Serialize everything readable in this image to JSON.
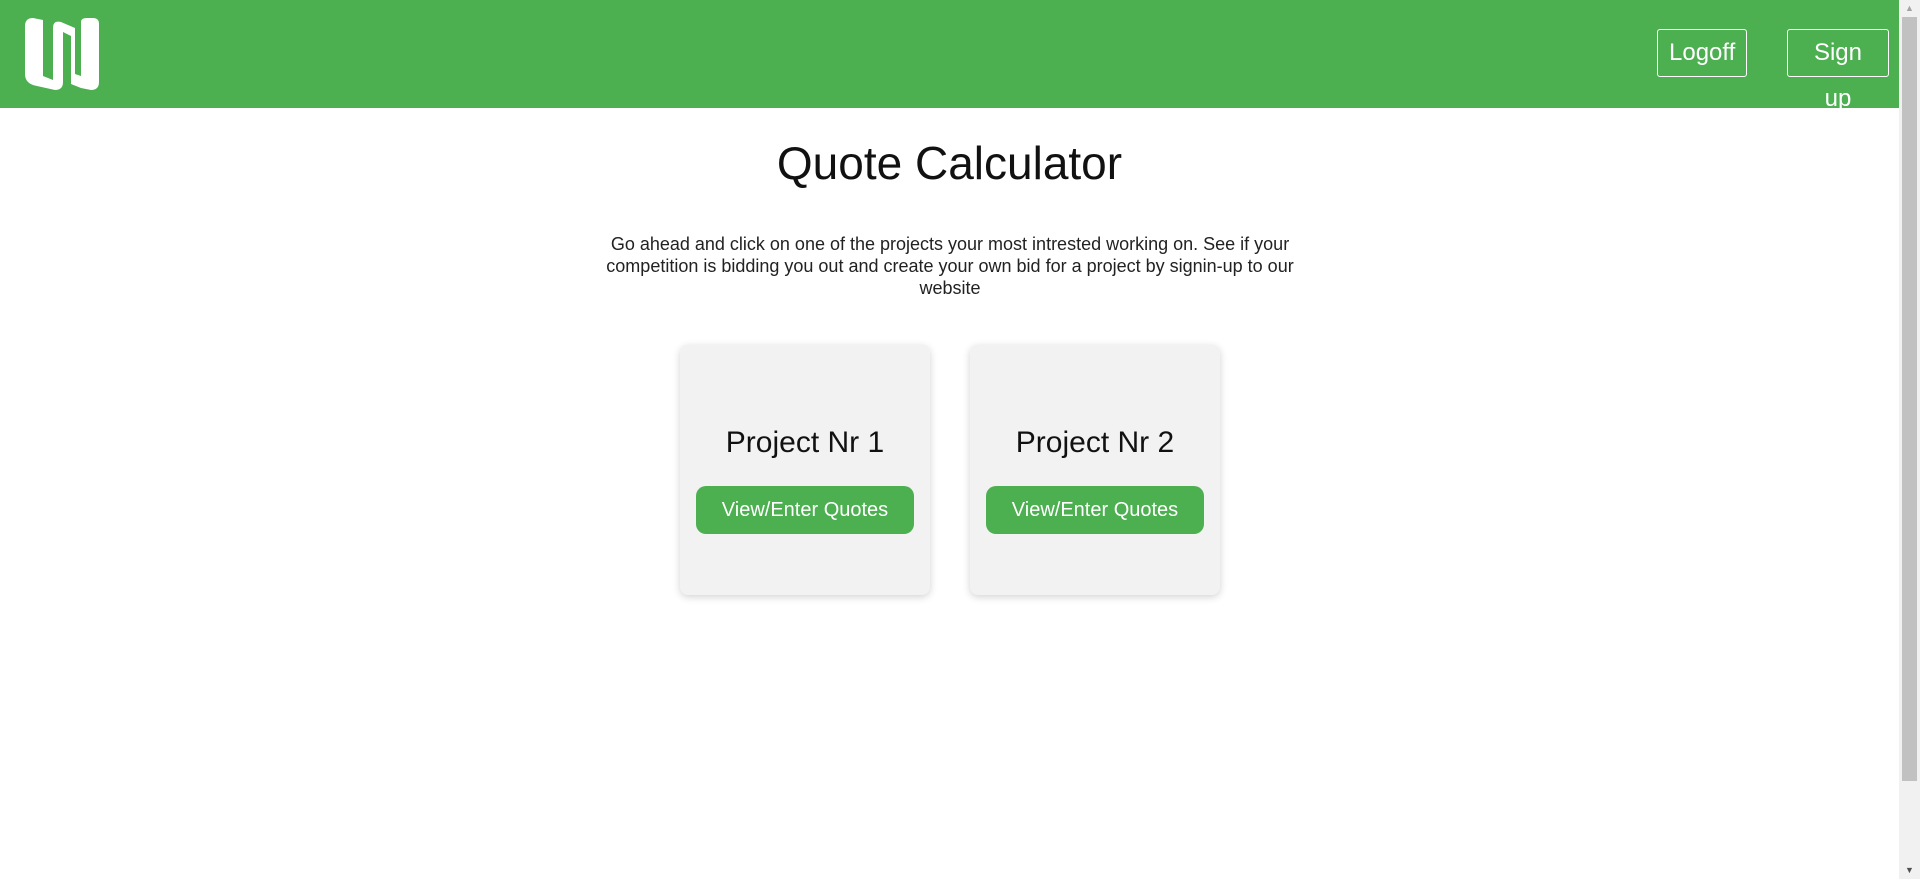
{
  "header": {
    "background_color": "#4caf50",
    "logo_icon": "brand-logo-icon",
    "logoff_label": "Logoff",
    "signup_label": "Sign up"
  },
  "main": {
    "title": "Quote Calculator",
    "intro": "Go ahead and click on one of the projects your most intrested working on. See if your competition is bidding you out and create your own bid for a project by signin-up to our website",
    "projects": [
      {
        "title": "Project Nr 1",
        "button_label": "View/Enter Quotes"
      },
      {
        "title": "Project Nr 2",
        "button_label": "View/Enter Quotes"
      }
    ]
  },
  "scrollbar": {
    "up_icon": "scroll-up-arrow-icon",
    "down_icon": "scroll-down-arrow-icon"
  }
}
